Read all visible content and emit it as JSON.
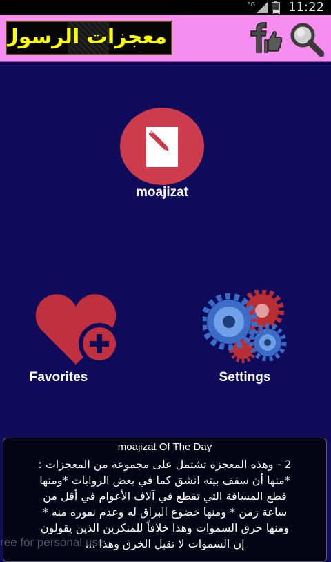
{
  "status_bar": {
    "network": "3G",
    "time": "11:22"
  },
  "app_bar": {
    "title": "معجزات الرسول"
  },
  "tiles": {
    "moajizat": {
      "label": "moajizat"
    },
    "favorites": {
      "label": "Favorites"
    },
    "settings": {
      "label": "Settings"
    }
  },
  "of_the_day": {
    "title": "moajizat Of The Day",
    "lines": [
      "2 - وهذه المعجزة تشتمل على مجموعة من المعجزات :",
      "*منها أن سقف بيته انشق كما في بعض الروايات *ومنها",
      "قطع المسافة التي تقطع في آلاف الأعوام في أقل من",
      "ساعة زمن * ومنها خضوع البراق له وعدم نفوره منه *",
      "ومنها خرق السموات  وهذا خلافاً للمنكرين الذين يقولون",
      "إن السموات لا تقبل الخرق  وهذا ..."
    ]
  },
  "watermark": "ree for personal use",
  "colors": {
    "background": "#0d0b5a",
    "app_bar": "#f68ef0",
    "title_text": "#ffff00",
    "accent_red": "#cc3c4d"
  },
  "icons": [
    "facebook-like-icon",
    "search-icon",
    "edit-note-icon",
    "heart-plus-icon",
    "gears-icon"
  ]
}
